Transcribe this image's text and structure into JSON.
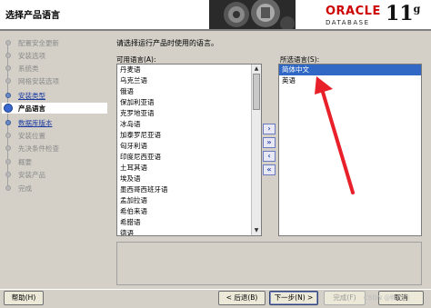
{
  "header": {
    "title": "选择产品语言",
    "brand": "ORACLE",
    "product_line": "DATABASE",
    "version": "11",
    "version_suffix": "g"
  },
  "nav": {
    "items": [
      {
        "label": "配置安全更新",
        "state": "pending"
      },
      {
        "label": "安装选项",
        "state": "pending"
      },
      {
        "label": "系统类",
        "state": "pending"
      },
      {
        "label": "网格安装选项",
        "state": "pending"
      },
      {
        "label": "安装类型",
        "state": "done"
      },
      {
        "label": "产品语言",
        "state": "current"
      },
      {
        "label": "数据库版本",
        "state": "done"
      },
      {
        "label": "安装位置",
        "state": "pending"
      },
      {
        "label": "先决条件检查",
        "state": "pending"
      },
      {
        "label": "概要",
        "state": "pending"
      },
      {
        "label": "安装产品",
        "state": "pending"
      },
      {
        "label": "完成",
        "state": "pending"
      }
    ]
  },
  "main": {
    "instruction": "请选择运行产品时使用的语言。",
    "available_label": "可用语言(A):",
    "selected_label": "所选语言(S):",
    "available_languages": [
      "丹麦语",
      "乌克兰语",
      "俄语",
      "保加利亚语",
      "克罗地亚语",
      "冰岛语",
      "加泰罗尼亚语",
      "匈牙利语",
      "印度尼西亚语",
      "土耳其语",
      "埃及语",
      "墨西哥西班牙语",
      "孟加拉语",
      "希伯来语",
      "希腊语",
      "德语"
    ],
    "selected_languages": [
      "简体中文",
      "英语"
    ],
    "selected_index": 0
  },
  "buttons": {
    "help": "帮助(H)",
    "back": "< 后退(B)",
    "next": "下一步(N) >",
    "finish": "完成(F)",
    "cancel": "取消"
  },
  "watermark": "CSDN @鸭川川",
  "colors": {
    "selection": "#3168c6",
    "annotation_arrow": "#e8202a",
    "brand_red": "#cc0000"
  }
}
